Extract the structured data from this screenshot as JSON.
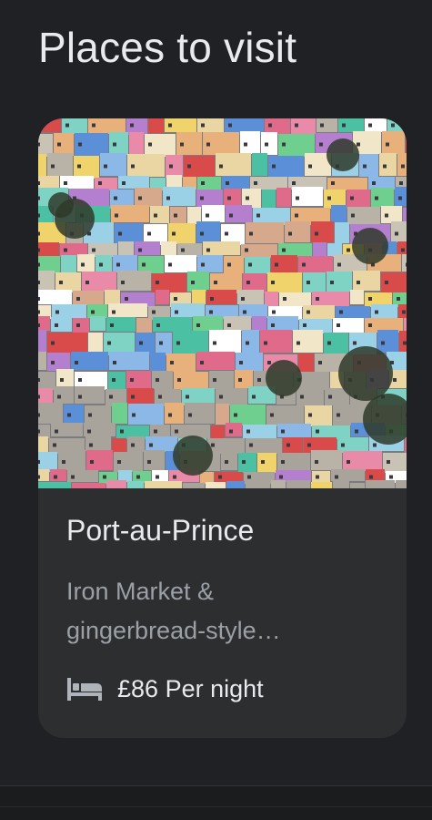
{
  "section": {
    "title": "Places to visit"
  },
  "card": {
    "name": "Port-au-Prince",
    "description_line1": "Iron Market &",
    "description_line2": "gingerbread-style…",
    "price": "£86",
    "price_unit": "Per night",
    "price_icon": "bed-icon"
  },
  "colors": {
    "background": "#202124",
    "card_background": "#2d2e30",
    "primary_text": "#e8eaed",
    "secondary_text": "#9aa0a6"
  }
}
